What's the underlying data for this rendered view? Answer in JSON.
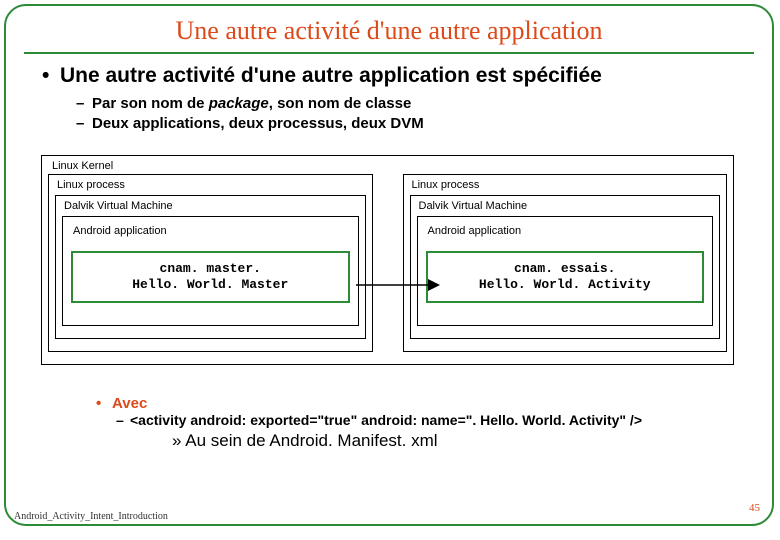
{
  "title": "Une autre activité d'une autre application",
  "bullets": {
    "main": "Une autre activité d'une autre application est spécifiée",
    "sub1a": "Par son nom de ",
    "sub1b": "package",
    "sub1c": ", son nom de classe",
    "sub2": "Deux applications, deux processus, deux DVM"
  },
  "diagram": {
    "kernel": "Linux Kernel",
    "process": "Linux process",
    "dvm": "Dalvik Virtual Machine",
    "app": "Android application",
    "box_left_1": "cnam. master.",
    "box_left_2": "Hello. World. Master",
    "box_right_1": "cnam. essais.",
    "box_right_2": "Hello. World. Activity"
  },
  "avec": {
    "label": "Avec",
    "code": "<activity android: exported=\"true\" android: name=\". Hello. World. Activity\" />",
    "manifest": "» Au sein de Android. Manifest. xml"
  },
  "footer": {
    "left": "Android_Activity_Intent_Introduction",
    "right": "45"
  }
}
